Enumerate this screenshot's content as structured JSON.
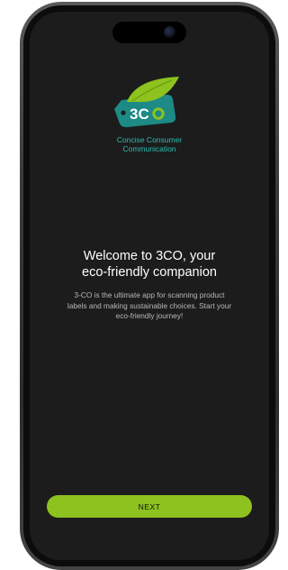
{
  "app": {
    "logo_text": "3CO",
    "logo_subtitle_line1": "Concise Consumer",
    "logo_subtitle_line2": "Communication"
  },
  "welcome": {
    "title_line1": "Welcome to 3CO, your",
    "title_line2": "eco-friendly companion",
    "description_line1": "3-CO is the ultimate app for scanning product",
    "description_line2": "labels and making sustainable choices. Start your",
    "description_line3": "eco-friendly journey!"
  },
  "actions": {
    "next_label": "NEXT"
  },
  "colors": {
    "background": "#1c1c1c",
    "accent": "#8dc21f",
    "logo_teal": "#1d8a86",
    "logo_green": "#8dc21f",
    "subtitle": "#2bbfb0"
  },
  "icons": {
    "logo": "leaf-tag-logo-icon",
    "camera": "front-camera-icon"
  }
}
